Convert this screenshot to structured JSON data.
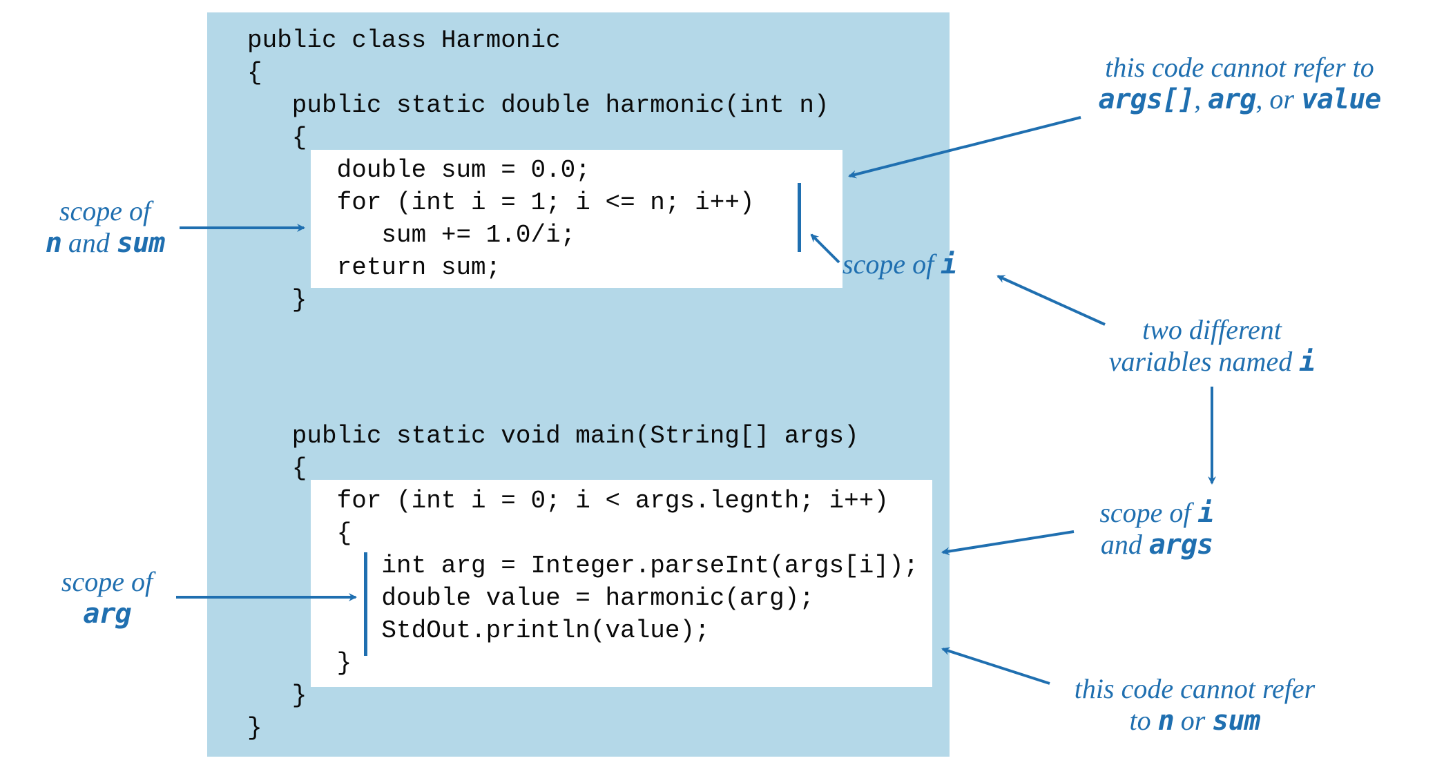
{
  "code": {
    "l1": "public class Harmonic",
    "l2": "{",
    "l3": "   public static double harmonic(int n)",
    "l4": "   {",
    "l5": "      double sum = 0.0;",
    "l6": "      for (int i = 1; i <= n; i++)",
    "l7": "         sum += 1.0/i;",
    "l8": "      return sum;",
    "l9": "   }",
    "l10": "   public static void main(String[] args)",
    "l11": "   {",
    "l12": "      for (int i = 0; i < args.legnth; i++)",
    "l13": "      {",
    "l14": "         int arg = Integer.parseInt(args[i]);",
    "l15": "         double value = harmonic(arg);",
    "l16": "         StdOut.println(value);",
    "l17": "      }",
    "l18": "   }",
    "l19": "}"
  },
  "annotations": {
    "scope_n_sum_1": "scope of",
    "scope_n_sum_2": "n",
    "scope_n_sum_3": " and ",
    "scope_n_sum_4": "sum",
    "scope_arg_1": "scope of",
    "scope_arg_2": "arg",
    "cannot_refer_args_1": "this code cannot refer to",
    "cannot_refer_args_2": "args[]",
    "cannot_refer_args_3": ", ",
    "cannot_refer_args_4": "arg",
    "cannot_refer_args_5": ", or ",
    "cannot_refer_args_6": "value",
    "scope_i": "scope of ",
    "scope_i_var": "i",
    "two_diff_1": "two different",
    "two_diff_2": "variables named ",
    "two_diff_3": "i",
    "scope_i_args_1": "scope of ",
    "scope_i_args_2": "i",
    "scope_i_args_3": "and ",
    "scope_i_args_4": "args",
    "cannot_refer_n_1": "this code cannot refer",
    "cannot_refer_n_2": "to ",
    "cannot_refer_n_3": "n",
    "cannot_refer_n_4": " or ",
    "cannot_refer_n_5": "sum"
  }
}
